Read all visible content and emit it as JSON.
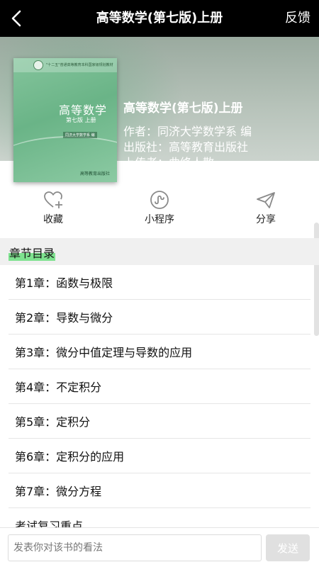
{
  "topbar": {
    "back_icon": "chevron-left-icon",
    "title": "高等数学(第七版)上册",
    "feedback_label": "反馈"
  },
  "book": {
    "title": "高等数学(第七版)上册",
    "author_line": "作者：同济大学数学系 编",
    "publisher_line": "出版社：高等教育出版社",
    "uploader_line": "上传者：曲终人散",
    "cover": {
      "series_text": "\"十二五\"普通高等教育本科国家级规划教材",
      "title": "高等数学",
      "edition": "第七版  上册",
      "author": "同济大学数学系 编",
      "publisher_logo": "高等教育出版社"
    }
  },
  "actions": [
    {
      "label": "收藏",
      "icon": "heart-plus-icon"
    },
    {
      "label": "小程序",
      "icon": "mini-program-icon"
    },
    {
      "label": "分享",
      "icon": "paper-plane-icon"
    }
  ],
  "section": {
    "title": "章节目录"
  },
  "chapters": [
    "第1章：函数与极限",
    "第2章：导数与微分",
    "第3章：微分中值定理与导数的应用",
    "第4章：不定积分",
    "第5章：定积分",
    "第6章：定积分的应用",
    "第7章：微分方程",
    "考试复习重点"
  ],
  "comment": {
    "placeholder": "发表你对该书的看法",
    "send_label": "发送"
  },
  "colors": {
    "topbar_bg": "#000000",
    "highlight": "#7ee28f",
    "icon_stroke": "#8a8a8a",
    "send_bg": "#e0e0e0"
  }
}
